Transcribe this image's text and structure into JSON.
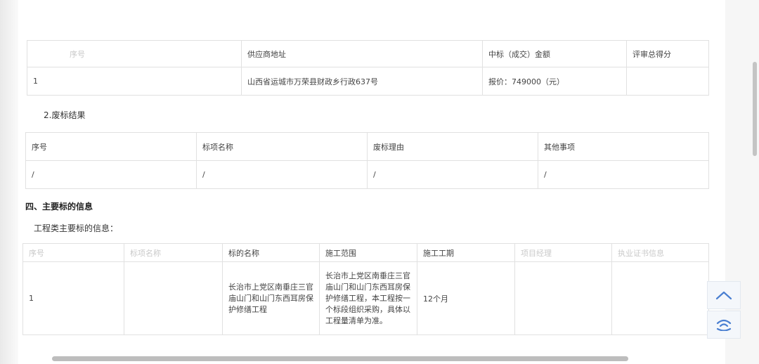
{
  "table1": {
    "headers": [
      "序号",
      "供应商地址",
      "中标（成交）金额",
      "评审总得分"
    ],
    "row": [
      "1",
      "山西省运城市万荣县财政乡行政637号",
      "报价：749000（元）",
      ""
    ]
  },
  "section2_title": "2.废标结果",
  "table2": {
    "headers": [
      "序号",
      "标项名称",
      "废标理由",
      "其他事项"
    ],
    "row": [
      "/",
      "/",
      "/",
      "/"
    ]
  },
  "section4_title": "四、主要标的信息",
  "subtitle": "工程类主要标的信息：",
  "table3": {
    "headers": [
      "序号",
      "标项名称",
      "标的名称",
      "施工范围",
      "施工工期",
      "项目经理",
      "执业证书信息"
    ],
    "row": [
      "1",
      "",
      "长治市上党区南垂庄三官庙山门和山门东西耳房保护修缮工程",
      "长治市上党区南垂庄三官庙山门和山门东西耳房保护修缮工程，本工程按一个标段组织采购，具体以工程量清单为准。",
      "12个月",
      "",
      ""
    ]
  }
}
